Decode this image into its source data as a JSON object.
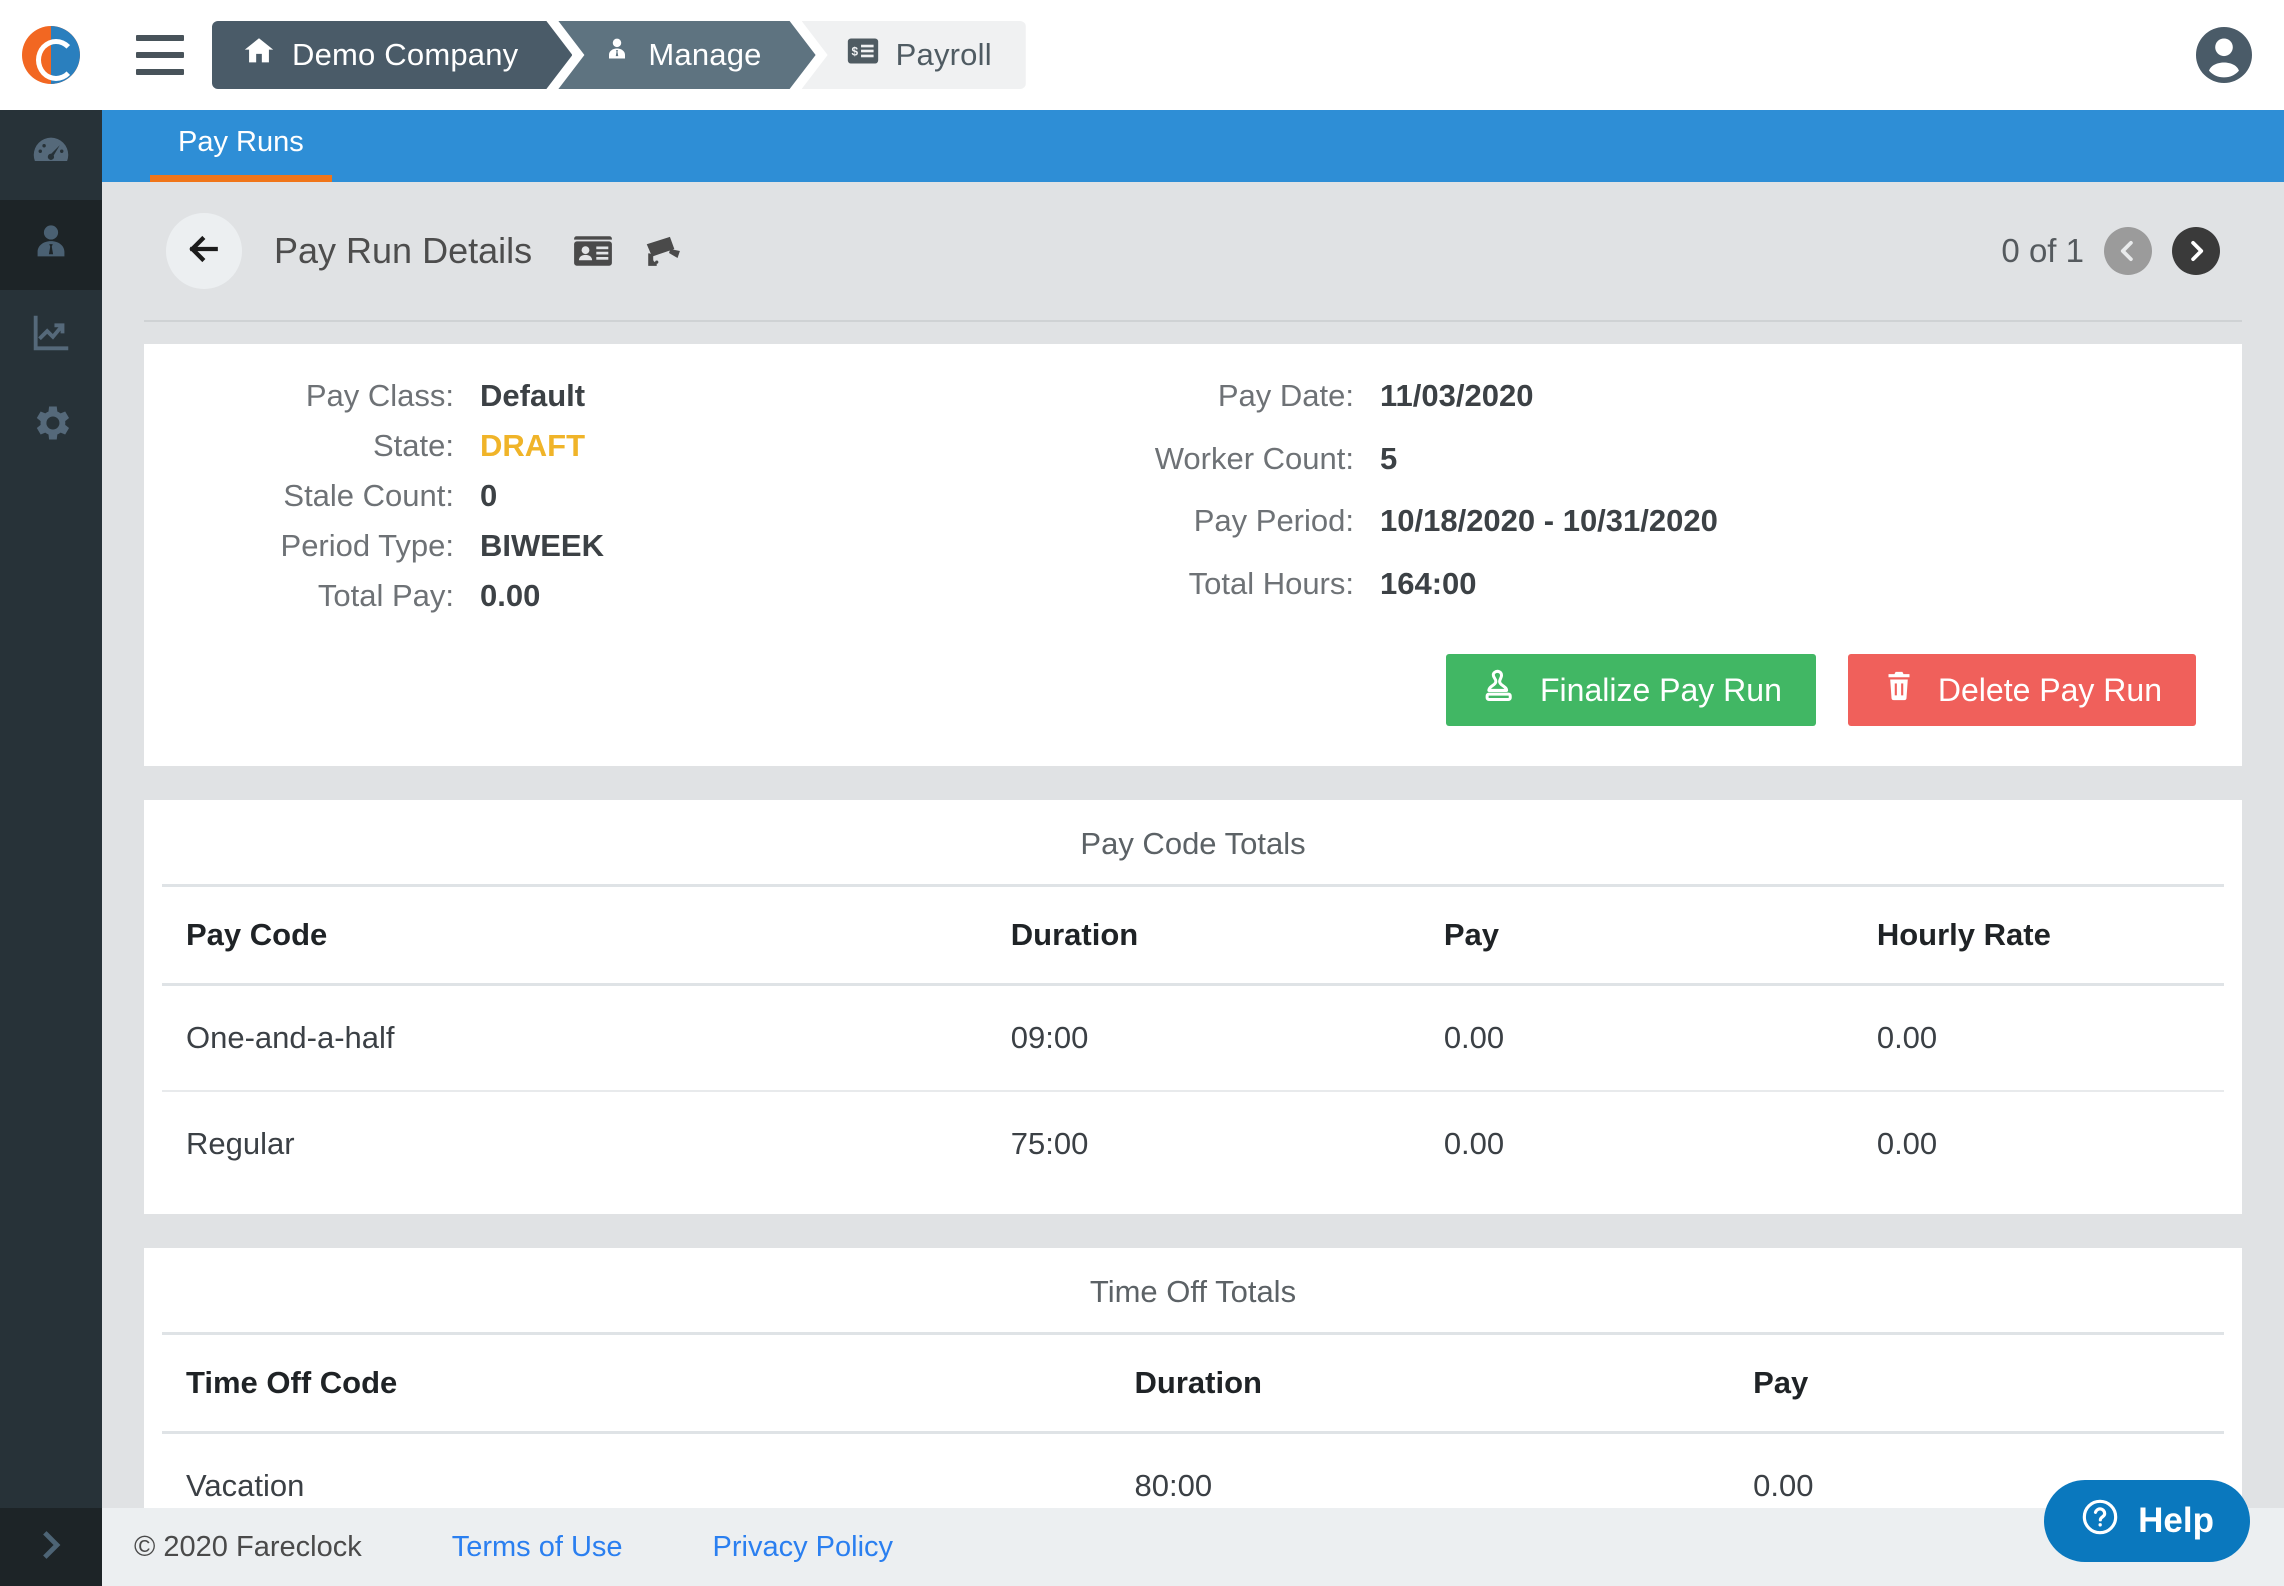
{
  "brand": {
    "logo_name": "fareclock-logo",
    "accent": "#f07519",
    "primary": "#2e8ed6"
  },
  "topbar": {
    "menu_label": "menu",
    "breadcrumbs": [
      {
        "label": "Demo Company",
        "icon": "home-icon"
      },
      {
        "label": "Manage",
        "icon": "user-tie-icon"
      },
      {
        "label": "Payroll",
        "icon": "payroll-icon"
      }
    ],
    "avatar_label": "account"
  },
  "sidebar": {
    "items": [
      {
        "name": "dashboard",
        "icon": "gauge-icon",
        "active": false
      },
      {
        "name": "people",
        "icon": "person-icon",
        "active": true
      },
      {
        "name": "reports",
        "icon": "chart-line-icon",
        "active": false
      },
      {
        "name": "settings",
        "icon": "gear-icon",
        "active": false
      }
    ],
    "expander_icon": "chevron-right-icon"
  },
  "tabs": [
    {
      "label": "Pay Runs",
      "active": true
    }
  ],
  "page": {
    "title": "Pay Run Details",
    "back_icon": "arrow-left-icon",
    "header_icons": [
      "id-card-icon",
      "security-camera-icon"
    ],
    "pager": {
      "label": "0 of 1",
      "prev_icon": "chevron-left-circle-icon",
      "next_icon": "chevron-right-circle-icon"
    }
  },
  "summary": {
    "left": [
      {
        "label": "Pay Class:",
        "value": "Default",
        "state": false
      },
      {
        "label": "State:",
        "value": "DRAFT",
        "state": true
      },
      {
        "label": "Stale Count:",
        "value": "0",
        "state": false
      },
      {
        "label": "Period Type:",
        "value": "BIWEEK",
        "state": false
      },
      {
        "label": "Total Pay:",
        "value": "0.00",
        "state": false
      }
    ],
    "right": [
      {
        "label": "Pay Date:",
        "value": "11/03/2020"
      },
      {
        "label": "Worker Count:",
        "value": "5"
      },
      {
        "label": "Pay Period:",
        "value": "10/18/2020 - 10/31/2020"
      },
      {
        "label": "Total Hours:",
        "value": "164:00"
      }
    ],
    "state_color": "#f0b429"
  },
  "actions": {
    "finalize_label": "Finalize Pay Run",
    "finalize_icon": "stamp-icon",
    "finalize_color": "#41b764",
    "delete_label": "Delete Pay Run",
    "delete_icon": "trash-icon",
    "delete_color": "#f0605b"
  },
  "pay_code_totals": {
    "title": "Pay Code Totals",
    "columns": [
      "Pay Code",
      "Duration",
      "Pay",
      "Hourly Rate"
    ],
    "rows": [
      [
        "One-and-a-half",
        "09:00",
        "0.00",
        "0.00"
      ],
      [
        "Regular",
        "75:00",
        "0.00",
        "0.00"
      ]
    ]
  },
  "time_off_totals": {
    "title": "Time Off Totals",
    "columns": [
      "Time Off Code",
      "Duration",
      "Pay"
    ],
    "rows": [
      [
        "Vacation",
        "80:00",
        "0.00"
      ]
    ]
  },
  "footer": {
    "copyright": "© 2020 Fareclock",
    "links": [
      "Terms of Use",
      "Privacy Policy"
    ],
    "link_color": "#2a7ff0"
  },
  "help": {
    "label": "Help",
    "icon": "question-circle-icon",
    "color": "#0a78be"
  }
}
